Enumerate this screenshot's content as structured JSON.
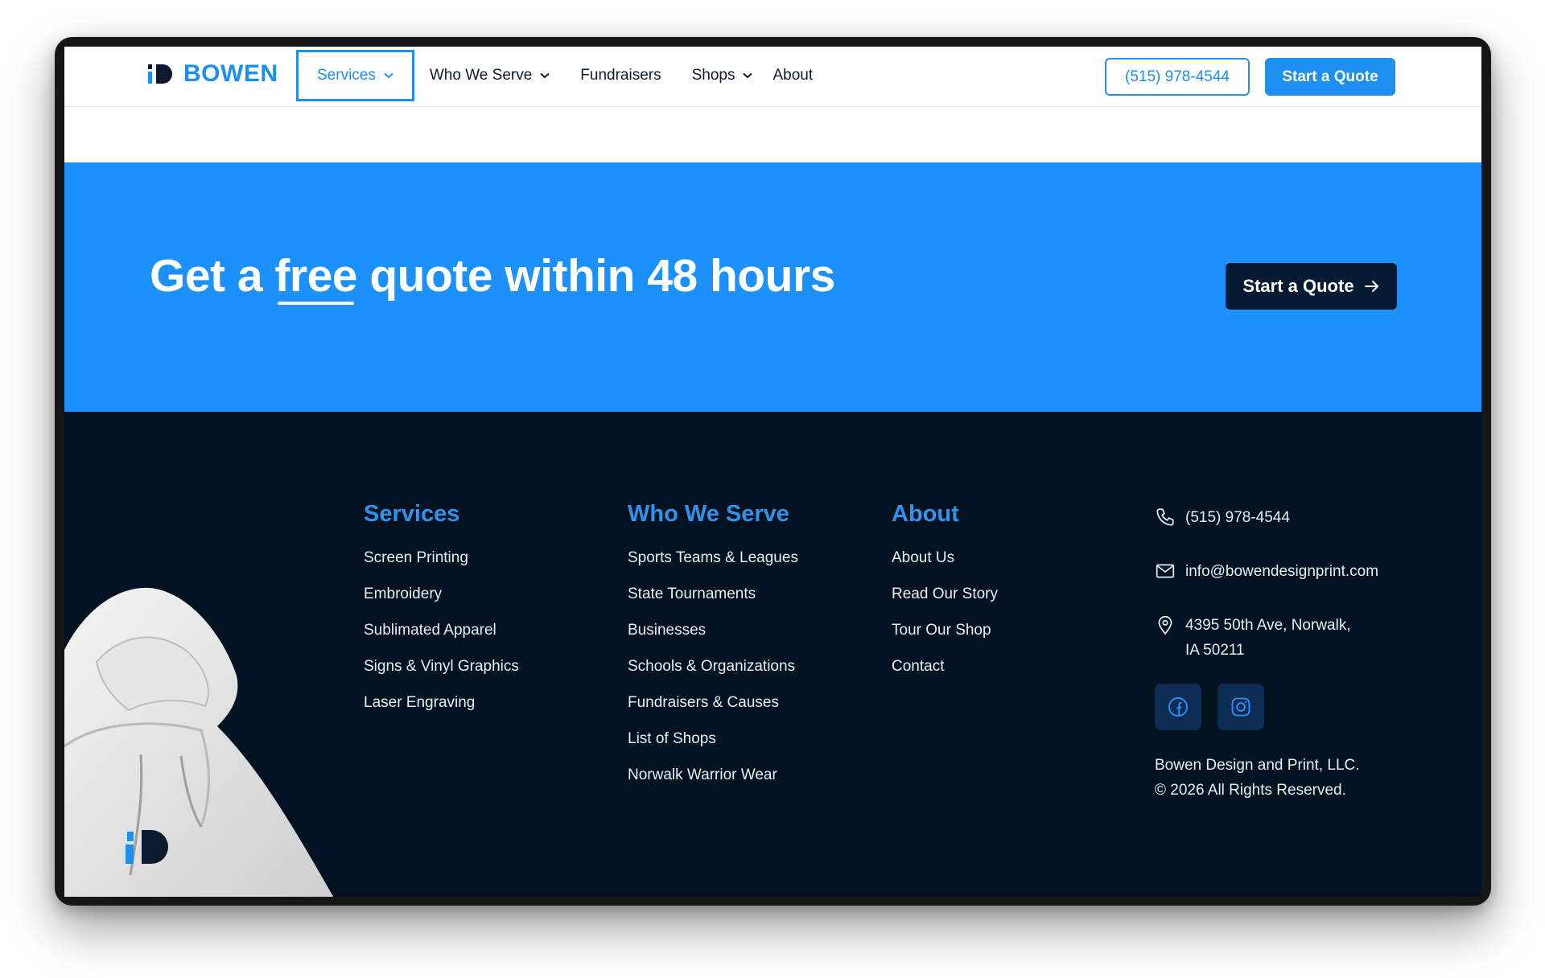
{
  "header": {
    "logo_text": "BOWEN",
    "nav": [
      {
        "label": "Services",
        "has_dropdown": true,
        "active": true
      },
      {
        "label": "Who We Serve",
        "has_dropdown": true
      },
      {
        "label": "Fundraisers",
        "has_dropdown": false
      },
      {
        "label": "Shops",
        "has_dropdown": true
      },
      {
        "label": "About",
        "has_dropdown": false
      }
    ],
    "phone": "(515) 978-4544",
    "quote_button": "Start a Quote"
  },
  "cta": {
    "title_before": "Get a ",
    "title_emphasis": "free",
    "title_after": " quote within 48 hours",
    "button": "Start a Quote",
    "button_icon": "arrow-right-icon"
  },
  "footer": {
    "columns": [
      {
        "title": "Services",
        "links": [
          "Screen Printing",
          "Embroidery",
          "Sublimated Apparel",
          "Signs & Vinyl Graphics",
          "Laser Engraving"
        ]
      },
      {
        "title": "Who We Serve",
        "links": [
          "Sports Teams & Leagues",
          "State Tournaments",
          "Businesses",
          "Schools & Organizations",
          "Fundraisers & Causes",
          "List of Shops",
          "Norwalk Warrior Wear"
        ]
      },
      {
        "title": "About",
        "links": [
          "About Us",
          "Read Our Story",
          "Tour Our Shop",
          "Contact"
        ]
      }
    ],
    "contact": {
      "phone": "(515) 978-4544",
      "email": "info@bowendesignprint.com",
      "address_line1": "4395 50th Ave, Norwalk,",
      "address_line2": "IA 50211"
    },
    "social": [
      "facebook-icon",
      "instagram-icon"
    ],
    "company": "Bowen Design and Print, LLC.",
    "rights": "© 2026 All Rights Reserved."
  },
  "colors": {
    "brand_blue": "#1c8ff0",
    "cta_band": "#1c90fb",
    "footer_bg": "#031221",
    "dark_button": "#071a34"
  }
}
